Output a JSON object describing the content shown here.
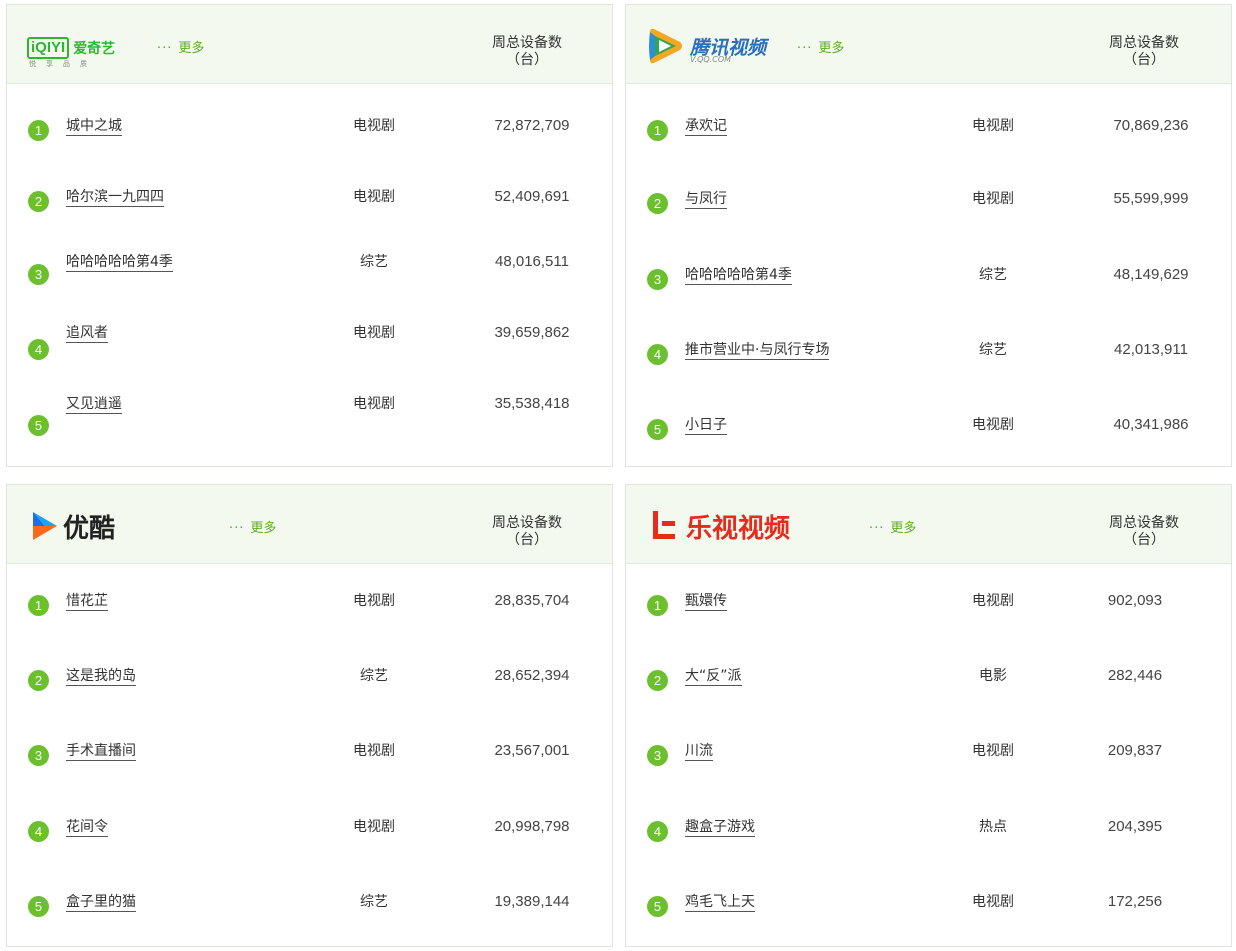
{
  "common": {
    "more_label": "更多",
    "more_dots": "···",
    "col_line1": "周总设备数",
    "col_line2": "（台）"
  },
  "iqiyi": {
    "logo_box": "iQIYI",
    "logo_text": "爱奇艺",
    "logo_sub": "悦享品质",
    "items": [
      {
        "rank": "1",
        "title": "城中之城",
        "cat": "电视剧",
        "num": "72,872,709"
      },
      {
        "rank": "2",
        "title": "哈尔滨一九四四",
        "cat": "电视剧",
        "num": "52,409,691"
      },
      {
        "rank": "3",
        "title": "哈哈哈哈哈第4季",
        "cat": "综艺",
        "num": "48,016,511"
      },
      {
        "rank": "4",
        "title": "追风者",
        "cat": "电视剧",
        "num": "39,659,862"
      },
      {
        "rank": "5",
        "title": "又见逍遥",
        "cat": "电视剧",
        "num": "35,538,418"
      }
    ]
  },
  "tencent": {
    "logo_text": "腾讯视频",
    "logo_sub": "V.QQ.COM",
    "items": [
      {
        "rank": "1",
        "title": "承欢记",
        "cat": "电视剧",
        "num": "70,869,236"
      },
      {
        "rank": "2",
        "title": "与凤行",
        "cat": "电视剧",
        "num": "55,599,999"
      },
      {
        "rank": "3",
        "title": "哈哈哈哈哈第4季",
        "cat": "综艺",
        "num": "48,149,629"
      },
      {
        "rank": "4",
        "title": "推市营业中·与凤行专场",
        "cat": "综艺",
        "num": "42,013,911"
      },
      {
        "rank": "5",
        "title": "小日子",
        "cat": "电视剧",
        "num": "40,341,986"
      }
    ]
  },
  "youku": {
    "logo_text": "优酷",
    "items": [
      {
        "rank": "1",
        "title": "惜花芷",
        "cat": "电视剧",
        "num": "28,835,704"
      },
      {
        "rank": "2",
        "title": "这是我的岛",
        "cat": "综艺",
        "num": "28,652,394"
      },
      {
        "rank": "3",
        "title": "手术直播间",
        "cat": "电视剧",
        "num": "23,567,001"
      },
      {
        "rank": "4",
        "title": "花间令",
        "cat": "电视剧",
        "num": "20,998,798"
      },
      {
        "rank": "5",
        "title": "盒子里的猫",
        "cat": "综艺",
        "num": "19,389,144"
      }
    ]
  },
  "letv": {
    "logo_text": "乐视视频",
    "items": [
      {
        "rank": "1",
        "title": "甄嬛传",
        "cat": "电视剧",
        "num": "902,093"
      },
      {
        "rank": "2",
        "title": "大“反”派",
        "cat": "电影",
        "num": "282,446"
      },
      {
        "rank": "3",
        "title": "川流",
        "cat": "电视剧",
        "num": "209,837"
      },
      {
        "rank": "4",
        "title": "趣盒子游戏",
        "cat": "热点",
        "num": "204,395"
      },
      {
        "rank": "5",
        "title": "鸡毛飞上天",
        "cat": "电视剧",
        "num": "172,256"
      }
    ]
  }
}
